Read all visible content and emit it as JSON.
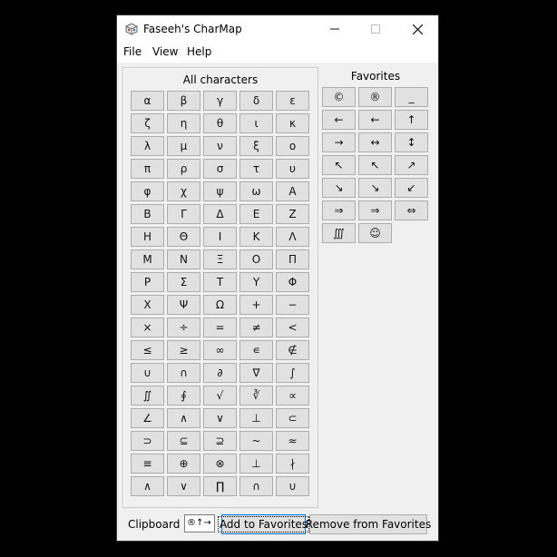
{
  "window": {
    "title": "Faseeh's CharMap",
    "controls": {
      "minimize": "—",
      "maximize": "☐",
      "close": "✕"
    }
  },
  "menu": [
    "File",
    "View",
    "Help"
  ],
  "all_characters": {
    "title": "All characters",
    "chars": [
      "α",
      "β",
      "γ",
      "δ",
      "ε",
      "ζ",
      "η",
      "θ",
      "ι",
      "κ",
      "λ",
      "μ",
      "ν",
      "ξ",
      "ο",
      "π",
      "ρ",
      "σ",
      "τ",
      "υ",
      "φ",
      "χ",
      "ψ",
      "ω",
      "Α",
      "Β",
      "Γ",
      "Δ",
      "Ε",
      "Ζ",
      "Η",
      "Θ",
      "Ι",
      "Κ",
      "Λ",
      "Μ",
      "Ν",
      "Ξ",
      "Ο",
      "Π",
      "Ρ",
      "Σ",
      "Τ",
      "Υ",
      "Φ",
      "Χ",
      "Ψ",
      "Ω",
      "+",
      "−",
      "×",
      "÷",
      "=",
      "≠",
      "<",
      "≤",
      "≥",
      "∞",
      "∊",
      "∉",
      "∪",
      "∩",
      "∂",
      "∇",
      "∫",
      "∬",
      "∮",
      "√",
      "∛",
      "∝",
      "∠",
      "∧",
      "∨",
      "⊥",
      "⊂",
      "⊃",
      "⊆",
      "⊇",
      "~",
      "≈",
      "≡",
      "⊕",
      "⊗",
      "⊥",
      "∤",
      "∧",
      "∨",
      "∏",
      "∩",
      "∪"
    ]
  },
  "favorites": {
    "title": "Favorites",
    "chars": [
      "©",
      "®",
      "_",
      "←",
      "←",
      "↑",
      "→",
      "↔",
      "↕",
      "↖",
      "↖",
      "↗",
      "↘",
      "↘",
      "↙",
      "⇒",
      "⇒",
      "⇔",
      "∭",
      "☺"
    ]
  },
  "bottom": {
    "clipboard_label": "Clipboard :",
    "clipboard_value": "®↑→",
    "add_label": "Add to Favorites",
    "remove_label": "Remove from Favorites"
  }
}
